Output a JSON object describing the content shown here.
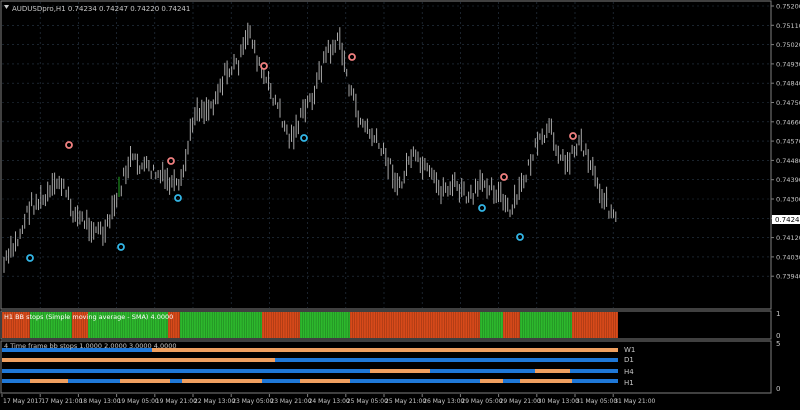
{
  "colors": {
    "background": "#000000",
    "grid": "#2b3a4a",
    "axis": "#7f7f7f",
    "text": "#c8c8c8",
    "bar": "#a9a9a9",
    "bullish_highlight": "#22aa22",
    "indicator_green": "#2db82d",
    "indicator_red": "#d84a1a",
    "line_blue": "#1f78d8",
    "line_orange": "#f0a060",
    "dot_pink": "#f08080",
    "dot_cyan": "#33b5e5",
    "price_label_bg": "#ffffff"
  },
  "main_chart": {
    "title": "AUDUSDpro,H1  0.74234 0.74247 0.74220 0.74241",
    "current_price": "0.74241",
    "price_labels": [
      "0.75200",
      "0.75110",
      "0.75020",
      "0.74930",
      "0.74840",
      "0.74750",
      "0.74660",
      "0.74570",
      "0.74480",
      "0.74390",
      "0.74300",
      "0.74210",
      "0.74120",
      "0.74030",
      "0.73940"
    ],
    "pink_dots_icon": "circle-icon",
    "cyan_dots_icon": "circle-icon"
  },
  "indicator1": {
    "label": "H1 BB stops (Simple moving average - SMA) 4.0000",
    "scale_top": "1",
    "scale_bottom": "0"
  },
  "indicator2": {
    "label": "4 Time frame bb stops 1.0000 2.0000 3.0000 4.0000",
    "scale_top": "5",
    "scale_bottom": "0",
    "lines": [
      "W1",
      "D1",
      "H4",
      "H1"
    ]
  },
  "time_axis": [
    "17 May 2017",
    "17 May 21:00",
    "18 May 13:00",
    "19 May 05:00",
    "19 May 21:00",
    "22 May 13:00",
    "23 May 05:00",
    "23 May 21:00",
    "24 May 13:00",
    "25 May 05:00",
    "25 May 21:00",
    "26 May 13:00",
    "29 May 05:00",
    "29 May 21:00",
    "30 May 13:00",
    "31 May 05:00",
    "31 May 21:00"
  ]
}
